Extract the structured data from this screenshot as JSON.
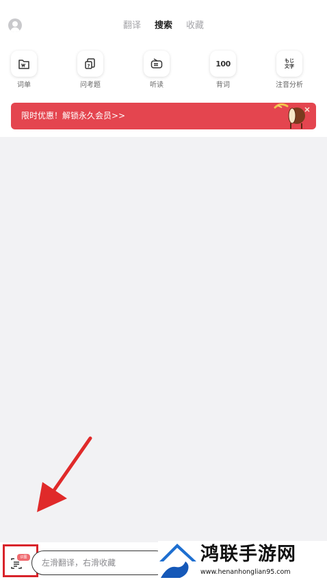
{
  "header": {
    "tabs": [
      {
        "label": "翻译",
        "active": false
      },
      {
        "label": "搜索",
        "active": true
      },
      {
        "label": "收藏",
        "active": false
      }
    ]
  },
  "tools": [
    {
      "label": "词单",
      "icon": "wordlist-icon"
    },
    {
      "label": "问考题",
      "icon": "quiz-icon"
    },
    {
      "label": "听读",
      "icon": "radio-icon"
    },
    {
      "label": "背词",
      "icon": "recite-100-icon",
      "icon_text": "100"
    },
    {
      "label": "注音分析",
      "icon": "furigana-icon",
      "icon_text_top": "もじ",
      "icon_text_bottom": "文字"
    }
  ],
  "banner": {
    "text": "限时优惠！解锁永久会员>>",
    "color": "#e4454f"
  },
  "bottom": {
    "ocr_badge": "识图",
    "search_placeholder": "左滑翻译，右滑收藏"
  },
  "watermark": {
    "title": "鸿联手游网",
    "url": "www.henanhonglian95.com"
  },
  "colors": {
    "accent": "#e4454f",
    "highlight_box": "#d8232a",
    "background": "#f2f2f4"
  }
}
